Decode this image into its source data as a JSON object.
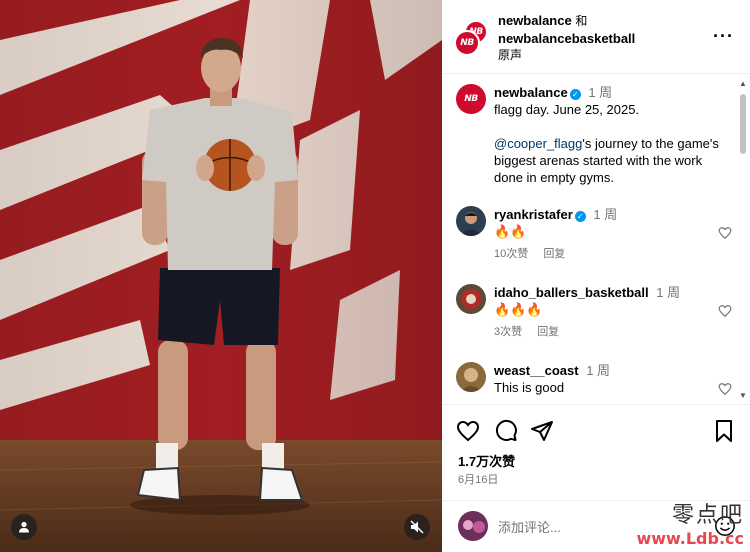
{
  "header": {
    "account_primary": "newbalance",
    "conjunction": "和",
    "account_secondary": "newbalancebasketball",
    "audio": "原声",
    "more_icon": "more-horizontal-icon"
  },
  "caption": {
    "username": "newbalance",
    "time": "1 周",
    "line1": "flagg day. June 25, 2025.",
    "mention": "@cooper_flagg",
    "line2": "'s journey to the game's biggest arenas started with the work done in empty gyms."
  },
  "comments": [
    {
      "username": "ryankristafer",
      "verified": true,
      "time": "1 周",
      "text": "🔥🔥",
      "likes": "10次赞",
      "reply": "回复"
    },
    {
      "username": "idaho_ballers_basketball",
      "verified": false,
      "time": "1 周",
      "text": "🔥🔥🔥",
      "likes": "3次赞",
      "reply": "回复"
    },
    {
      "username": "weast__coast",
      "verified": false,
      "time": "1 周",
      "text": "This is good",
      "likes": "",
      "reply": ""
    }
  ],
  "actions": {
    "likes_count": "1.7万次赞",
    "date": "6月16日"
  },
  "comment_input": {
    "placeholder": "添加评论..."
  },
  "watermark": {
    "text": "零点吧",
    "url": "www.Ldb.cc"
  },
  "colors": {
    "brand_red": "#cf0a2c",
    "verified_blue": "#0095f6",
    "muted_gray": "#737373"
  }
}
